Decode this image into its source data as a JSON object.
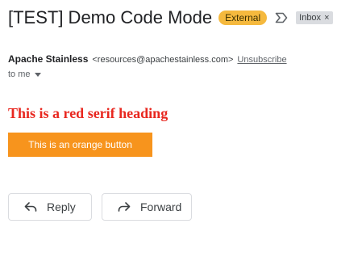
{
  "subject": {
    "title": "[TEST] Demo Code Mode",
    "external_badge": "External",
    "label": "Inbox",
    "label_close": "×"
  },
  "sender": {
    "name": "Apache Stainless",
    "email": "<resources@apachestainless.com>",
    "unsubscribe": "Unsubscribe",
    "to": "to me"
  },
  "body": {
    "heading": "This is a red serif heading",
    "button_label": "This is an orange button"
  },
  "actions": {
    "reply": "Reply",
    "forward": "Forward"
  },
  "colors": {
    "heading": "#e8271f",
    "button": "#f7941d",
    "external_badge": "#f5b93e"
  },
  "icons": {
    "important": "important-marker-icon",
    "reply": "reply-arrow-icon",
    "forward": "forward-arrow-icon",
    "recipients_caret": "caret-down-icon"
  }
}
